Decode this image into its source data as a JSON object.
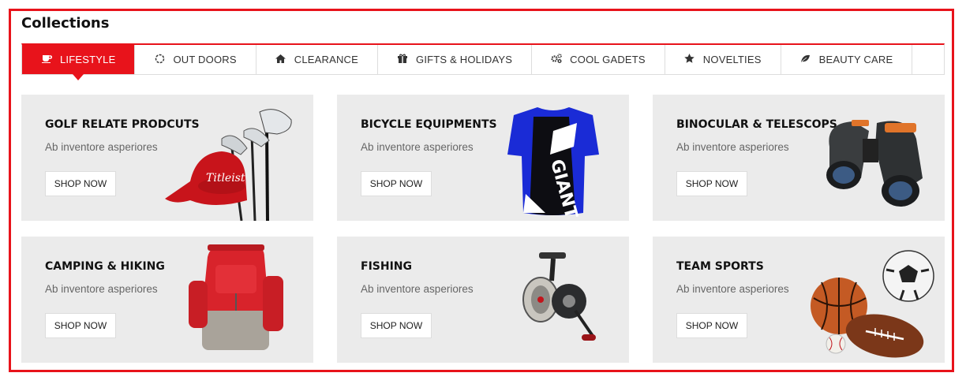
{
  "section": {
    "title": "Collections",
    "accent_color": "#e8131b"
  },
  "tabs": [
    {
      "label": "LIFESTYLE",
      "icon": "coffee-cup-icon",
      "active": true
    },
    {
      "label": "OUT DOORS",
      "icon": "circle-notch-icon"
    },
    {
      "label": "CLEARANCE",
      "icon": "home-icon"
    },
    {
      "label": "GIFTS & HOLIDAYS",
      "icon": "gift-icon"
    },
    {
      "label": "COOL GADETS",
      "icon": "gears-icon"
    },
    {
      "label": "NOVELTIES",
      "icon": "star-icon"
    },
    {
      "label": "BEAUTY CARE",
      "icon": "leaf-icon"
    }
  ],
  "cards": [
    {
      "title": "GOLF RELATE PRODCUTS",
      "subtitle": "Ab inventore asperiores",
      "button": "SHOP NOW",
      "image": "golf-clubs-and-cap"
    },
    {
      "title": "BICYCLE EQUIPMENTS",
      "subtitle": "Ab inventore asperiores",
      "button": "SHOP NOW",
      "image": "cycling-jersey"
    },
    {
      "title": "BINOCULAR & TELESCOPS",
      "subtitle": "Ab inventore asperiores",
      "button": "SHOP NOW",
      "image": "binoculars"
    },
    {
      "title": "CAMPING & HIKING",
      "subtitle": "Ab inventore asperiores",
      "button": "SHOP NOW",
      "image": "backpack"
    },
    {
      "title": "FISHING",
      "subtitle": "Ab inventore asperiores",
      "button": "SHOP NOW",
      "image": "fishing-reel"
    },
    {
      "title": "TEAM SPORTS",
      "subtitle": "Ab inventore asperiores",
      "button": "SHOP NOW",
      "image": "sports-balls"
    }
  ]
}
